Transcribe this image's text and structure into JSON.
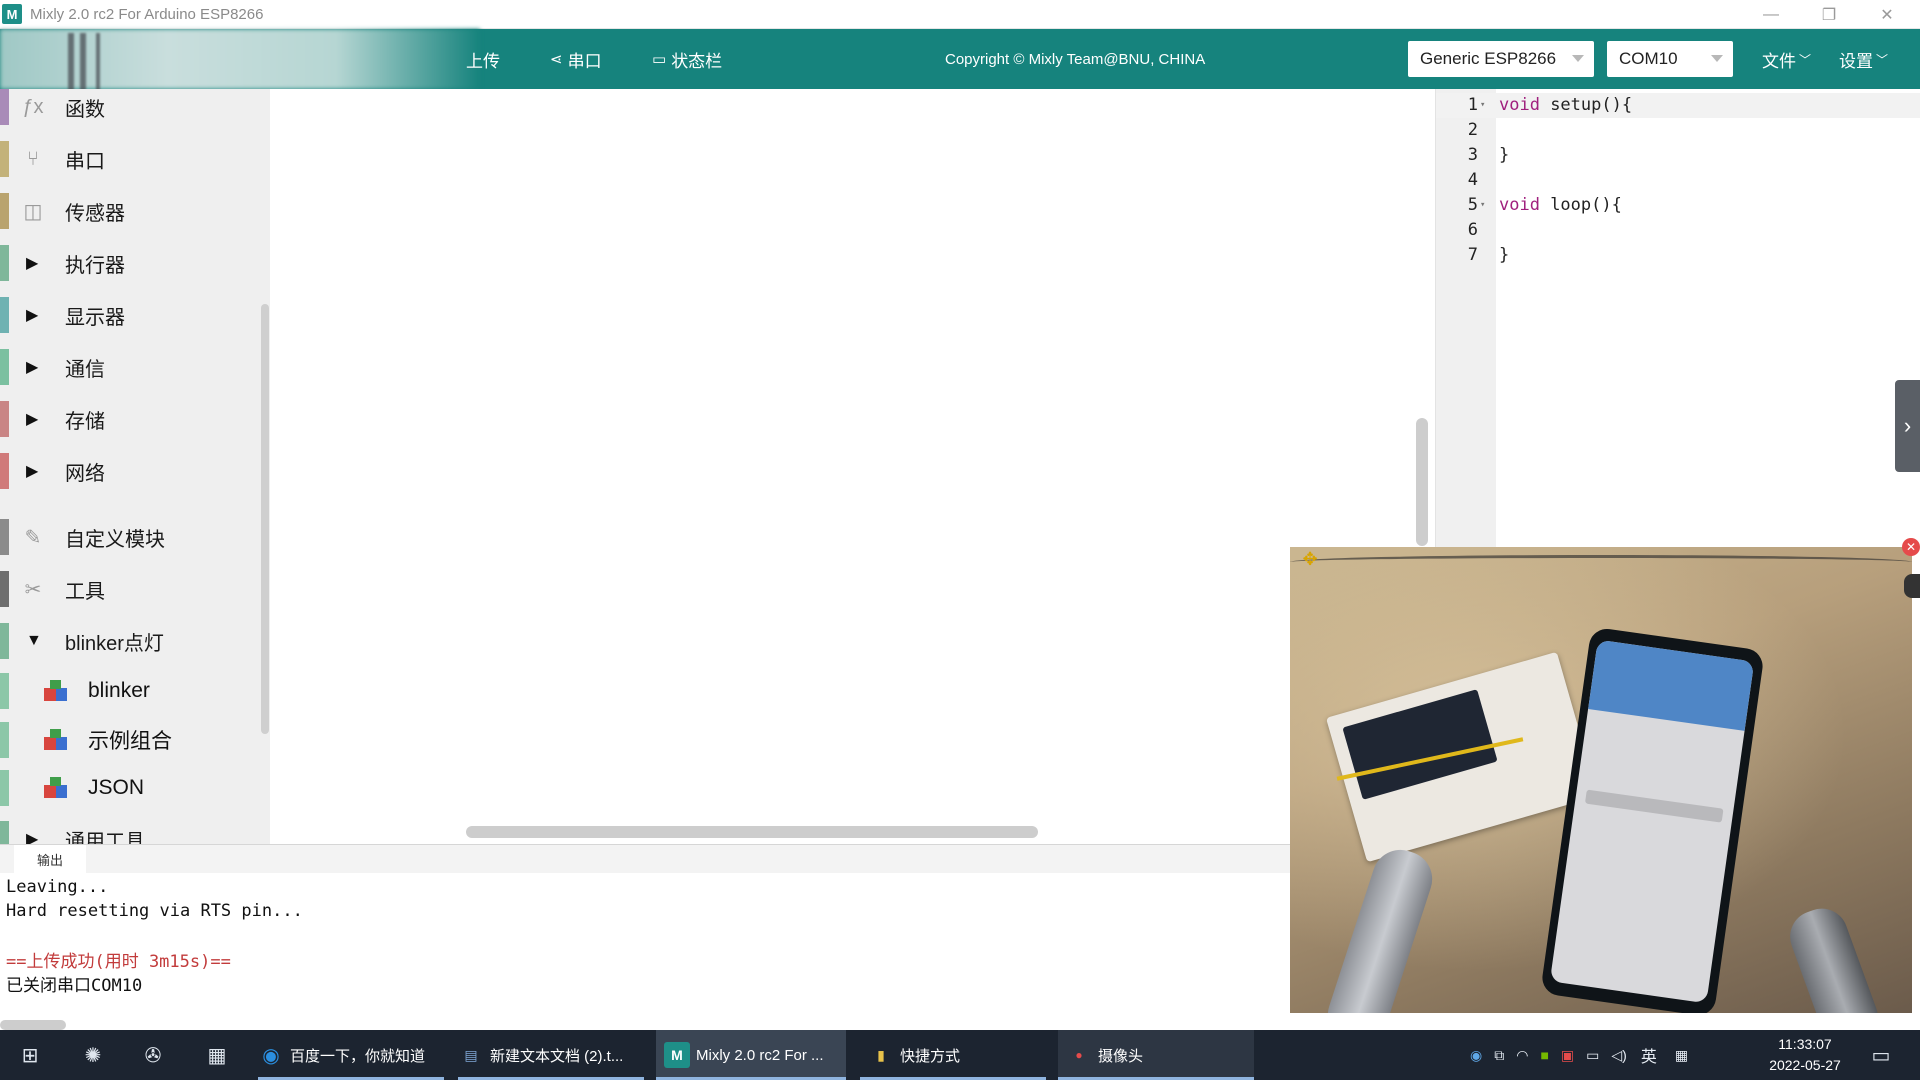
{
  "window": {
    "title": "Mixly 2.0 rc2 For Arduino ESP8266",
    "app_icon_letter": "M",
    "controls": [
      "—",
      "❐",
      "✕"
    ]
  },
  "toolbar": {
    "upload_label": "上传",
    "serial_label": "串口",
    "statusbar_label": "状态栏",
    "copyright": "Copyright © Mixly Team@BNU, CHINA",
    "board_select": "Generic ESP8266",
    "port_select": "COM10",
    "file_menu": "文件",
    "settings_menu": "设置"
  },
  "sidebar": {
    "categories": [
      {
        "label": "函数",
        "color": "#a98bb8",
        "icon": "fx-icon",
        "expanded": null
      },
      {
        "label": "串口",
        "color": "#c3b27a",
        "icon": "serial-icon",
        "expanded": null
      },
      {
        "label": "传感器",
        "color": "#b9a36e",
        "icon": "sensor-icon",
        "expanded": null
      },
      {
        "label": "执行器",
        "color": "#7fb79a",
        "icon": "triangle-right-icon",
        "expanded": false
      },
      {
        "label": "显示器",
        "color": "#6fb2b2",
        "icon": "triangle-right-icon",
        "expanded": false
      },
      {
        "label": "通信",
        "color": "#7bc0a0",
        "icon": "triangle-right-icon",
        "expanded": false
      },
      {
        "label": "存储",
        "color": "#c98585",
        "icon": "triangle-right-icon",
        "expanded": false
      },
      {
        "label": "网络",
        "color": "#d07a7a",
        "icon": "triangle-right-icon",
        "expanded": false
      },
      {
        "label": "自定义模块",
        "color": "#8b8b8b",
        "icon": "pen-icon",
        "expanded": null
      },
      {
        "label": "工具",
        "color": "#6e6e6e",
        "icon": "tools-icon",
        "expanded": null
      },
      {
        "label": "blinker点灯",
        "color": "#7fb79a",
        "icon": "triangle-down-icon",
        "expanded": true
      }
    ],
    "subitems": [
      {
        "label": "blinker"
      },
      {
        "label": "示例组合"
      },
      {
        "label": "JSON"
      }
    ],
    "partial_last": "通用工具"
  },
  "editor": {
    "lines": [
      {
        "n": "1",
        "fold": true,
        "kw": "void",
        "rest": " setup(){"
      },
      {
        "n": "2",
        "fold": false,
        "kw": "",
        "rest": ""
      },
      {
        "n": "3",
        "fold": false,
        "kw": "",
        "rest": "}"
      },
      {
        "n": "4",
        "fold": false,
        "kw": "",
        "rest": ""
      },
      {
        "n": "5",
        "fold": true,
        "kw": "void",
        "rest": " loop(){"
      },
      {
        "n": "6",
        "fold": false,
        "kw": "",
        "rest": ""
      },
      {
        "n": "7",
        "fold": false,
        "kw": "",
        "rest": "}"
      }
    ],
    "keyword_color": "#a0207e"
  },
  "output": {
    "tab_label": "输出",
    "lines": [
      "Leaving...",
      "Hard resetting via RTS pin...",
      "",
      "==上传成功(用时 3m15s)==",
      "已关闭串口COM10"
    ]
  },
  "taskbar": {
    "tasks": [
      {
        "label": "百度一下，你就知道",
        "icon": "edge-icon"
      },
      {
        "label": "新建文本文档 (2).t...",
        "icon": "notepad-icon"
      },
      {
        "label": "Mixly 2.0 rc2 For ...",
        "icon": "mixly-icon"
      },
      {
        "label": "快捷方式",
        "icon": "folder-icon"
      },
      {
        "label": "摄像头",
        "icon": "camera-icon"
      }
    ],
    "ime": "英",
    "time": "11:33:07",
    "date": "2022-05-27"
  },
  "colors": {
    "toolbar": "#16837d",
    "taskbar": "#1c2430"
  }
}
